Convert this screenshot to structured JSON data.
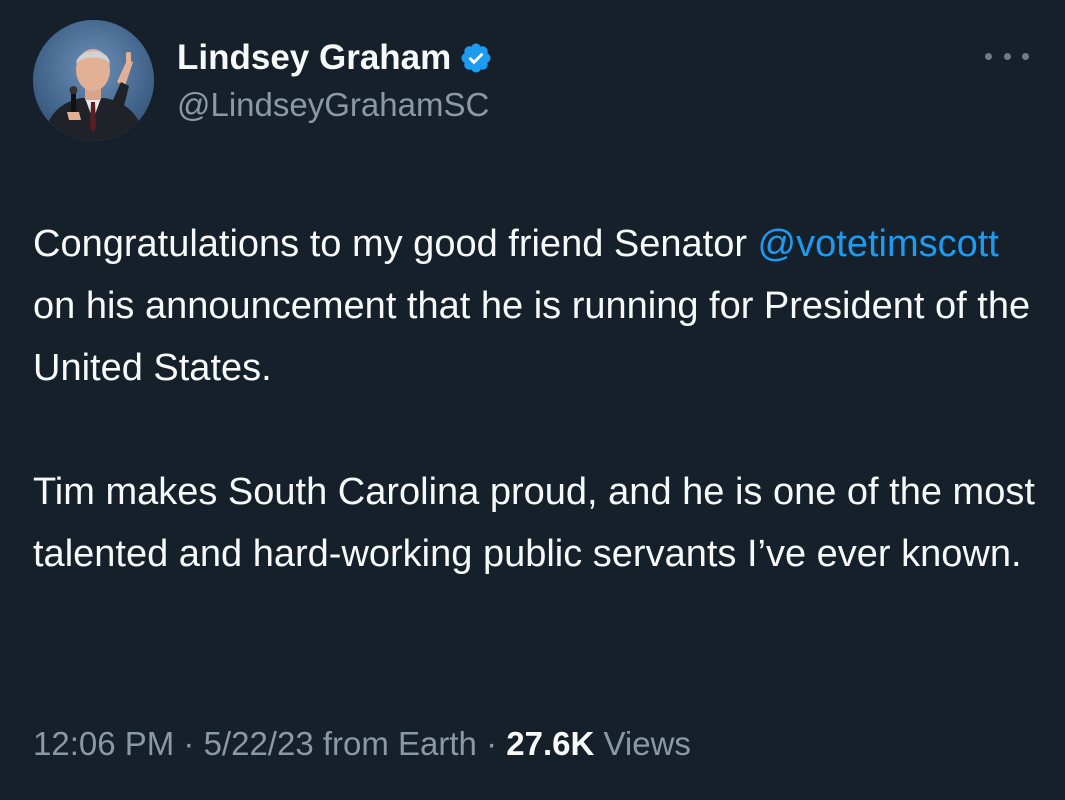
{
  "author": {
    "display_name": "Lindsey Graham",
    "handle": "@LindseyGrahamSC",
    "verified": true,
    "verified_icon": "verified-badge-icon",
    "avatar_icon": "profile-photo"
  },
  "menu": {
    "more_icon": "more-horizontal-icon"
  },
  "tweet": {
    "paragraph1_before_mention": "Congratulations to my good friend Senator ",
    "mention": "@votetimscott",
    "paragraph1_after_mention": " on his announcement that he is running for President of the United States.",
    "paragraph2": "Tim makes South Carolina proud, and he is one of the most talented and hard-working public servants I’ve ever known."
  },
  "meta": {
    "time": "12:06 PM",
    "sep1": " · ",
    "date": "5/22/23",
    "source": " from Earth",
    "sep2": " · ",
    "views_count": "27.6K",
    "views_label": " Views"
  },
  "colors": {
    "background": "#15202b",
    "text": "#f7f9f9",
    "secondary_text": "#8b98a5",
    "link": "#1d9bf0",
    "verified": "#1d9bf0"
  }
}
